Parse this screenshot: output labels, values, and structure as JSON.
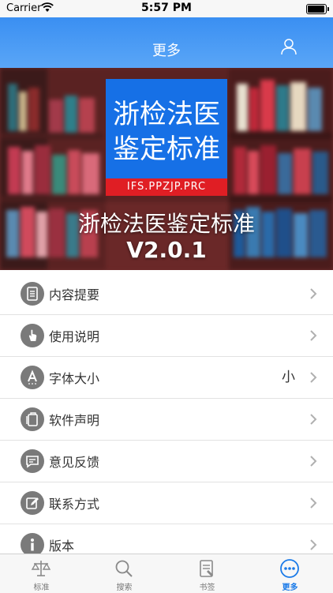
{
  "status_bar": {
    "carrier": "Carrier",
    "time": "5:57 PM",
    "battery_level": 1.0
  },
  "nav": {
    "title": "更多",
    "user_icon": "user-icon"
  },
  "banner": {
    "logo_line1": "浙检法医",
    "logo_line2": "鉴定标准",
    "logo_strip": "IFS.PPZJP.PRC",
    "app_name": "浙检法医鉴定标准",
    "version": "V2.0.1"
  },
  "menu": [
    {
      "label": "内容提要",
      "icon": "document-icon",
      "value": ""
    },
    {
      "label": "使用说明",
      "icon": "hand-pointer-icon",
      "value": ""
    },
    {
      "label": "字体大小",
      "icon": "font-size-icon",
      "value": "小"
    },
    {
      "label": "软件声明",
      "icon": "clipboard-icon",
      "value": ""
    },
    {
      "label": "意见反馈",
      "icon": "feedback-icon",
      "value": ""
    },
    {
      "label": "联系方式",
      "icon": "edit-icon",
      "value": ""
    },
    {
      "label": "版本",
      "icon": "info-icon",
      "value": ""
    }
  ],
  "tabs": [
    {
      "label": "标准",
      "icon": "scale-icon",
      "active": false
    },
    {
      "label": "搜索",
      "icon": "search-icon",
      "active": false
    },
    {
      "label": "书签",
      "icon": "bookmark-icon",
      "active": false
    },
    {
      "label": "更多",
      "icon": "more-icon",
      "active": true
    }
  ],
  "colors": {
    "nav": "#3a8ff2",
    "accent": "#1a7ae8",
    "icon_bg": "#7a7a7a",
    "logo": "#1670e6",
    "logo_strip": "#e01e24"
  }
}
